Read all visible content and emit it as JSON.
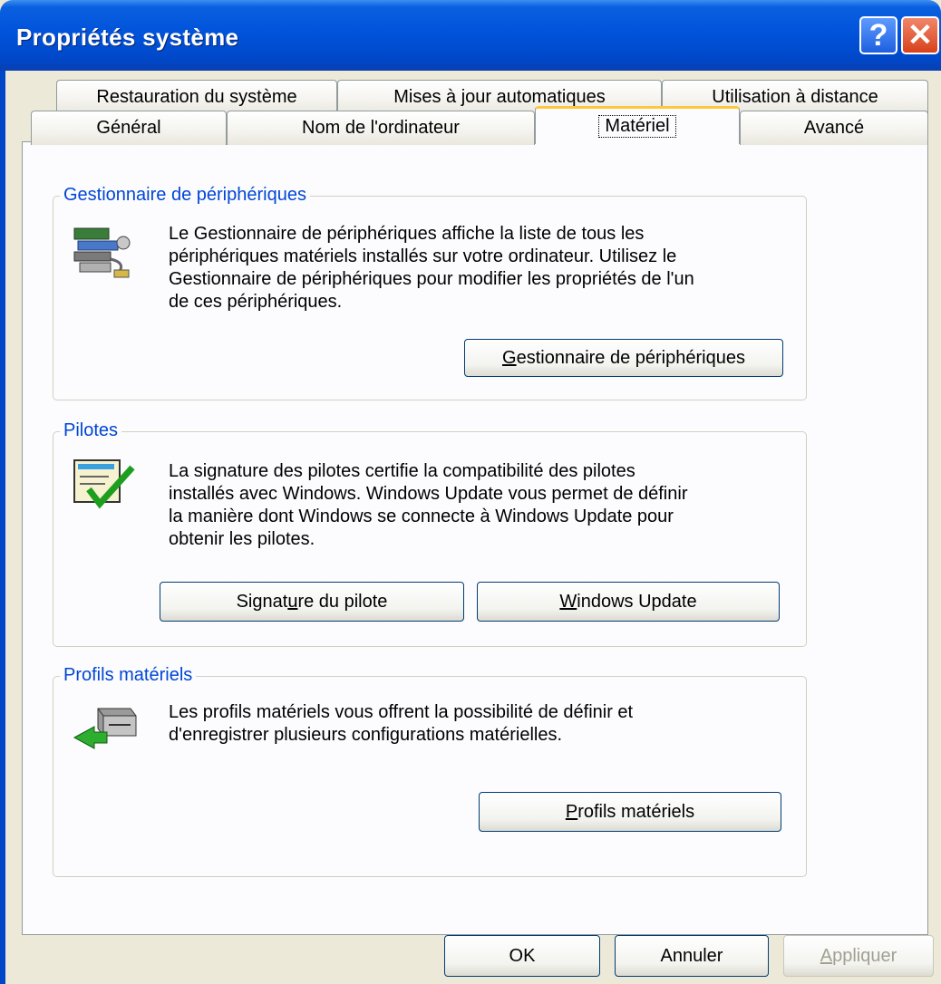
{
  "window": {
    "title": "Propriétés système"
  },
  "tabs_back": [
    {
      "label": "Restauration du système"
    },
    {
      "label": "Mises à jour automatiques"
    },
    {
      "label": "Utilisation à distance"
    }
  ],
  "tabs_front": [
    {
      "label": "Général"
    },
    {
      "label": "Nom de l'ordinateur"
    },
    {
      "label": "Matériel"
    },
    {
      "label": "Avancé"
    }
  ],
  "device_manager": {
    "title": "Gestionnaire de périphériques",
    "lines": [
      "Le Gestionnaire de périphériques affiche la liste de tous les",
      "périphériques matériels installés sur votre ordinateur. Utilisez le",
      "Gestionnaire de périphériques pour modifier les propriétés de l'un",
      "de ces périphériques."
    ],
    "button": {
      "pre": "",
      "ul": "G",
      "post": "estionnaire de périphériques"
    }
  },
  "drivers": {
    "title": "Pilotes",
    "lines": [
      "La signature des pilotes certifie la compatibilité des pilotes",
      "installés avec Windows. Windows Update vous permet de définir",
      "la manière dont Windows se connecte à Windows Update pour",
      "obtenir les pilotes."
    ],
    "sign_button": {
      "pre": "Signat",
      "ul": "u",
      "post": "re du pilote"
    },
    "update_button": {
      "pre": "",
      "ul": "W",
      "post": "indows Update"
    }
  },
  "profiles": {
    "title": "Profils matériels",
    "lines": [
      "Les profils matériels vous offrent la possibilité de définir et",
      "d'enregistrer plusieurs configurations matérielles."
    ],
    "button": {
      "pre": "",
      "ul": "P",
      "post": "rofils matériels"
    }
  },
  "footer": {
    "ok": "OK",
    "cancel": "Annuler",
    "apply": {
      "pre": "",
      "ul": "A",
      "post": "ppliquer"
    }
  }
}
